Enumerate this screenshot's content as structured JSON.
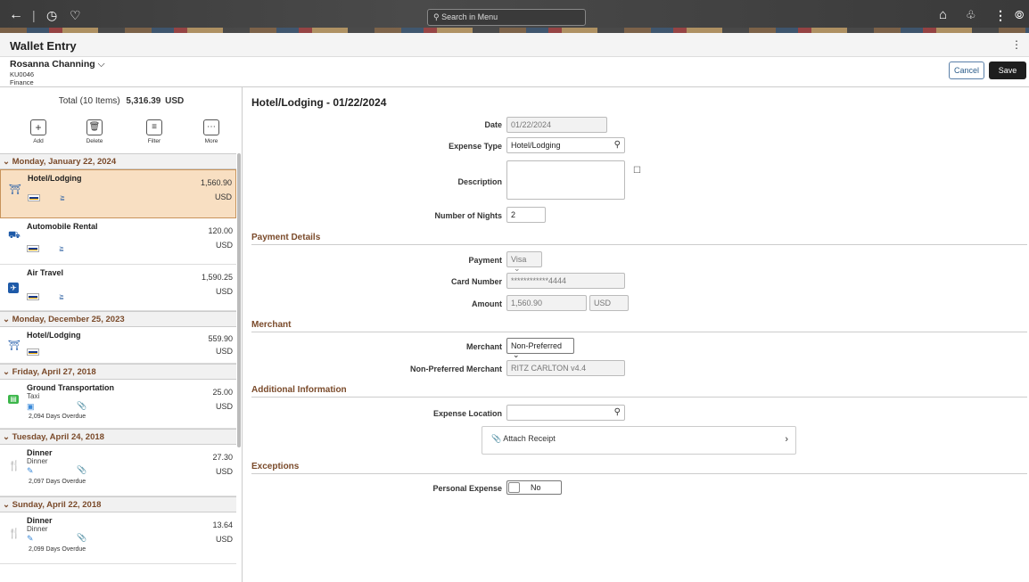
{
  "topbar": {
    "search_placeholder": "Search in Menu",
    "icons": [
      "back-arrow-icon",
      "history-icon",
      "heart-icon",
      "home-icon",
      "bell-icon",
      "kebab-icon",
      "compass-icon"
    ]
  },
  "page": {
    "title": "Wallet Entry"
  },
  "user": {
    "name": "Rosanna Channing",
    "id": "KU0046",
    "department": "Finance"
  },
  "actions": {
    "cancel": "Cancel",
    "save": "Save"
  },
  "summary": {
    "label": "Total (10 Items)",
    "amount": "5,316.39",
    "currency": "USD"
  },
  "toolbar": {
    "add": "Add",
    "delete": "Delete",
    "filter": "Filter",
    "more": "More"
  },
  "groups": [
    {
      "date": "Monday, January 22, 2024",
      "items": [
        {
          "name": "Hotel/Lodging",
          "amount": "1,560.90",
          "currency": "USD",
          "icon": "hotel-icon"
        },
        {
          "name": "Automobile Rental",
          "amount": "120.00",
          "currency": "USD",
          "icon": "car-icon"
        },
        {
          "name": "Air Travel",
          "amount": "1,590.25",
          "currency": "USD",
          "icon": "airplane-icon"
        }
      ]
    },
    {
      "date": "Monday, December 25, 2023",
      "items": [
        {
          "name": "Hotel/Lodging",
          "amount": "559.90",
          "currency": "USD",
          "icon": "hotel-icon"
        }
      ]
    },
    {
      "date": "Friday, April 27, 2018",
      "items": [
        {
          "name": "Ground Transportation",
          "sub": "Taxi",
          "amount": "25.00",
          "currency": "USD",
          "overdue": "2,094 Days Overdue",
          "icon": "bus-icon"
        }
      ]
    },
    {
      "date": "Tuesday, April 24, 2018",
      "items": [
        {
          "name": "Dinner",
          "sub": "Dinner",
          "amount": "27.30",
          "currency": "USD",
          "overdue": "2,097 Days Overdue",
          "icon": "utensils-icon"
        }
      ]
    },
    {
      "date": "Sunday, April 22, 2018",
      "items": [
        {
          "name": "Dinner",
          "sub": "Dinner",
          "amount": "13.64",
          "currency": "USD",
          "overdue": "2,099 Days Overdue",
          "icon": "utensils-icon"
        }
      ]
    }
  ],
  "detail": {
    "title": "Hotel/Lodging - 01/22/2024",
    "date_label": "Date",
    "date_value": "01/22/2024",
    "expense_type_label": "Expense Type",
    "expense_type_value": "Hotel/Lodging",
    "description_label": "Description",
    "description_value": "",
    "nights_label": "Number of Nights",
    "nights_value": "2",
    "payment_section": "Payment Details",
    "payment_label": "Payment",
    "payment_value": "Visa",
    "card_label": "Card Number",
    "card_value": "************4444",
    "amount_label": "Amount",
    "amount_value": "1,560.90",
    "amount_currency": "USD",
    "merchant_section": "Merchant",
    "merchant_label": "Merchant",
    "merchant_value": "Non-Preferred",
    "npm_label": "Non-Preferred Merchant",
    "npm_value": "RITZ CARLTON v4.4",
    "additional_section": "Additional Information",
    "location_label": "Expense Location",
    "location_value": "",
    "attach_label": "Attach Receipt",
    "exceptions_section": "Exceptions",
    "personal_label": "Personal Expense",
    "personal_value": "No"
  }
}
